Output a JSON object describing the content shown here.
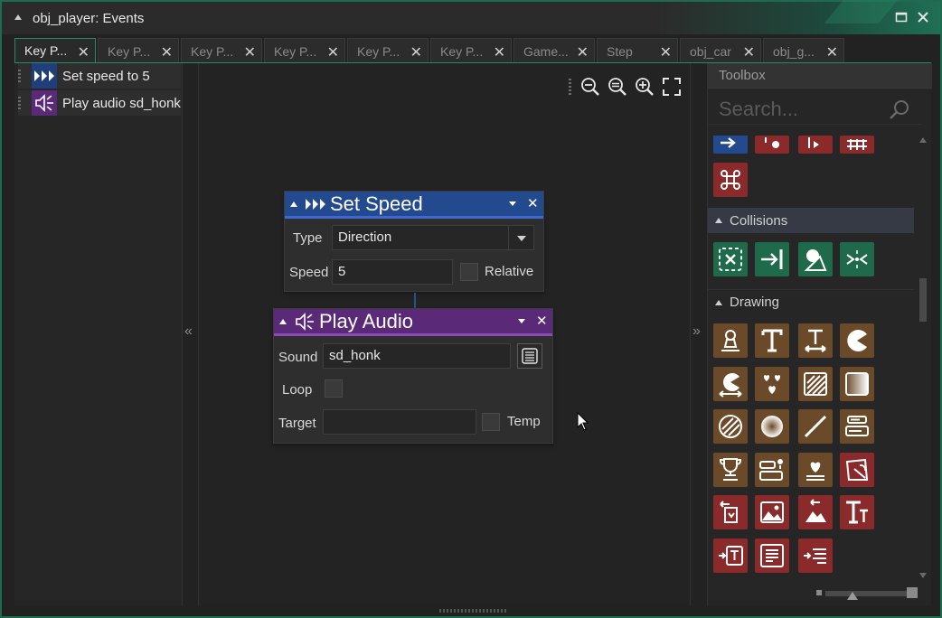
{
  "window": {
    "title": "obj_player: Events"
  },
  "tabs": [
    {
      "label": "Key P...",
      "active": true
    },
    {
      "label": "Key P..."
    },
    {
      "label": "Key P..."
    },
    {
      "label": "Key P..."
    },
    {
      "label": "Key P..."
    },
    {
      "label": "Key P..."
    },
    {
      "label": "Game..."
    },
    {
      "label": "Step"
    },
    {
      "label": "obj_car"
    },
    {
      "label": "obj_g..."
    }
  ],
  "event_list": [
    {
      "label": "Set speed to 5",
      "icon": "speed-arrows-icon",
      "color": "#1e3f7a"
    },
    {
      "label": "Play audio sd_honk",
      "icon": "speaker-icon",
      "color": "#5a2a78"
    }
  ],
  "blocks": {
    "set_speed": {
      "title": "Set Speed",
      "color": "#23498f",
      "type_label": "Type",
      "type_value": "Direction",
      "speed_label": "Speed",
      "speed_value": "5",
      "relative_label": "Relative"
    },
    "play_audio": {
      "title": "Play Audio",
      "color": "#5a2a78",
      "sound_label": "Sound",
      "sound_value": "sd_honk",
      "loop_label": "Loop",
      "target_label": "Target",
      "target_value": "",
      "temp_label": "Temp"
    }
  },
  "toolbox": {
    "header": "Toolbox",
    "search_placeholder": "Search...",
    "categories": [
      {
        "label": "Collisions"
      },
      {
        "label": "Drawing"
      }
    ],
    "colors": {
      "movement": "#23498f",
      "red": "#8a2a2a",
      "green": "#1e6a4a",
      "brown": "#6b4a2a"
    }
  }
}
